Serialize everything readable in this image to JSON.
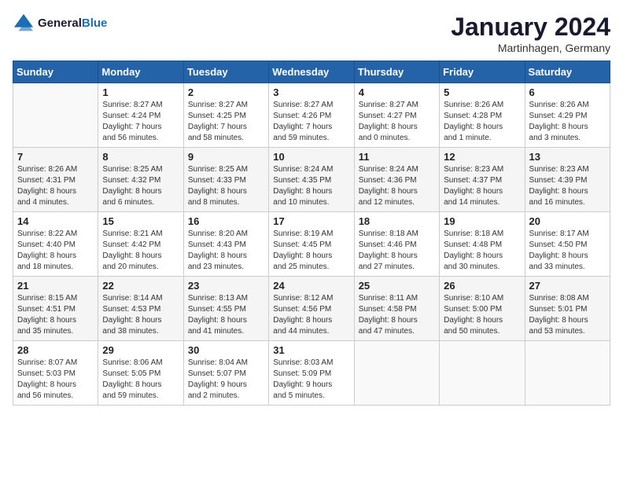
{
  "header": {
    "logo_general": "General",
    "logo_blue": "Blue",
    "month_title": "January 2024",
    "location": "Martinhagen, Germany"
  },
  "weekdays": [
    "Sunday",
    "Monday",
    "Tuesday",
    "Wednesday",
    "Thursday",
    "Friday",
    "Saturday"
  ],
  "weeks": [
    [
      {
        "day": "",
        "info": ""
      },
      {
        "day": "1",
        "info": "Sunrise: 8:27 AM\nSunset: 4:24 PM\nDaylight: 7 hours\nand 56 minutes."
      },
      {
        "day": "2",
        "info": "Sunrise: 8:27 AM\nSunset: 4:25 PM\nDaylight: 7 hours\nand 58 minutes."
      },
      {
        "day": "3",
        "info": "Sunrise: 8:27 AM\nSunset: 4:26 PM\nDaylight: 7 hours\nand 59 minutes."
      },
      {
        "day": "4",
        "info": "Sunrise: 8:27 AM\nSunset: 4:27 PM\nDaylight: 8 hours\nand 0 minutes."
      },
      {
        "day": "5",
        "info": "Sunrise: 8:26 AM\nSunset: 4:28 PM\nDaylight: 8 hours\nand 1 minute."
      },
      {
        "day": "6",
        "info": "Sunrise: 8:26 AM\nSunset: 4:29 PM\nDaylight: 8 hours\nand 3 minutes."
      }
    ],
    [
      {
        "day": "7",
        "info": "Sunrise: 8:26 AM\nSunset: 4:31 PM\nDaylight: 8 hours\nand 4 minutes."
      },
      {
        "day": "8",
        "info": "Sunrise: 8:25 AM\nSunset: 4:32 PM\nDaylight: 8 hours\nand 6 minutes."
      },
      {
        "day": "9",
        "info": "Sunrise: 8:25 AM\nSunset: 4:33 PM\nDaylight: 8 hours\nand 8 minutes."
      },
      {
        "day": "10",
        "info": "Sunrise: 8:24 AM\nSunset: 4:35 PM\nDaylight: 8 hours\nand 10 minutes."
      },
      {
        "day": "11",
        "info": "Sunrise: 8:24 AM\nSunset: 4:36 PM\nDaylight: 8 hours\nand 12 minutes."
      },
      {
        "day": "12",
        "info": "Sunrise: 8:23 AM\nSunset: 4:37 PM\nDaylight: 8 hours\nand 14 minutes."
      },
      {
        "day": "13",
        "info": "Sunrise: 8:23 AM\nSunset: 4:39 PM\nDaylight: 8 hours\nand 16 minutes."
      }
    ],
    [
      {
        "day": "14",
        "info": "Sunrise: 8:22 AM\nSunset: 4:40 PM\nDaylight: 8 hours\nand 18 minutes."
      },
      {
        "day": "15",
        "info": "Sunrise: 8:21 AM\nSunset: 4:42 PM\nDaylight: 8 hours\nand 20 minutes."
      },
      {
        "day": "16",
        "info": "Sunrise: 8:20 AM\nSunset: 4:43 PM\nDaylight: 8 hours\nand 23 minutes."
      },
      {
        "day": "17",
        "info": "Sunrise: 8:19 AM\nSunset: 4:45 PM\nDaylight: 8 hours\nand 25 minutes."
      },
      {
        "day": "18",
        "info": "Sunrise: 8:18 AM\nSunset: 4:46 PM\nDaylight: 8 hours\nand 27 minutes."
      },
      {
        "day": "19",
        "info": "Sunrise: 8:18 AM\nSunset: 4:48 PM\nDaylight: 8 hours\nand 30 minutes."
      },
      {
        "day": "20",
        "info": "Sunrise: 8:17 AM\nSunset: 4:50 PM\nDaylight: 8 hours\nand 33 minutes."
      }
    ],
    [
      {
        "day": "21",
        "info": "Sunrise: 8:15 AM\nSunset: 4:51 PM\nDaylight: 8 hours\nand 35 minutes."
      },
      {
        "day": "22",
        "info": "Sunrise: 8:14 AM\nSunset: 4:53 PM\nDaylight: 8 hours\nand 38 minutes."
      },
      {
        "day": "23",
        "info": "Sunrise: 8:13 AM\nSunset: 4:55 PM\nDaylight: 8 hours\nand 41 minutes."
      },
      {
        "day": "24",
        "info": "Sunrise: 8:12 AM\nSunset: 4:56 PM\nDaylight: 8 hours\nand 44 minutes."
      },
      {
        "day": "25",
        "info": "Sunrise: 8:11 AM\nSunset: 4:58 PM\nDaylight: 8 hours\nand 47 minutes."
      },
      {
        "day": "26",
        "info": "Sunrise: 8:10 AM\nSunset: 5:00 PM\nDaylight: 8 hours\nand 50 minutes."
      },
      {
        "day": "27",
        "info": "Sunrise: 8:08 AM\nSunset: 5:01 PM\nDaylight: 8 hours\nand 53 minutes."
      }
    ],
    [
      {
        "day": "28",
        "info": "Sunrise: 8:07 AM\nSunset: 5:03 PM\nDaylight: 8 hours\nand 56 minutes."
      },
      {
        "day": "29",
        "info": "Sunrise: 8:06 AM\nSunset: 5:05 PM\nDaylight: 8 hours\nand 59 minutes."
      },
      {
        "day": "30",
        "info": "Sunrise: 8:04 AM\nSunset: 5:07 PM\nDaylight: 9 hours\nand 2 minutes."
      },
      {
        "day": "31",
        "info": "Sunrise: 8:03 AM\nSunset: 5:09 PM\nDaylight: 9 hours\nand 5 minutes."
      },
      {
        "day": "",
        "info": ""
      },
      {
        "day": "",
        "info": ""
      },
      {
        "day": "",
        "info": ""
      }
    ]
  ]
}
